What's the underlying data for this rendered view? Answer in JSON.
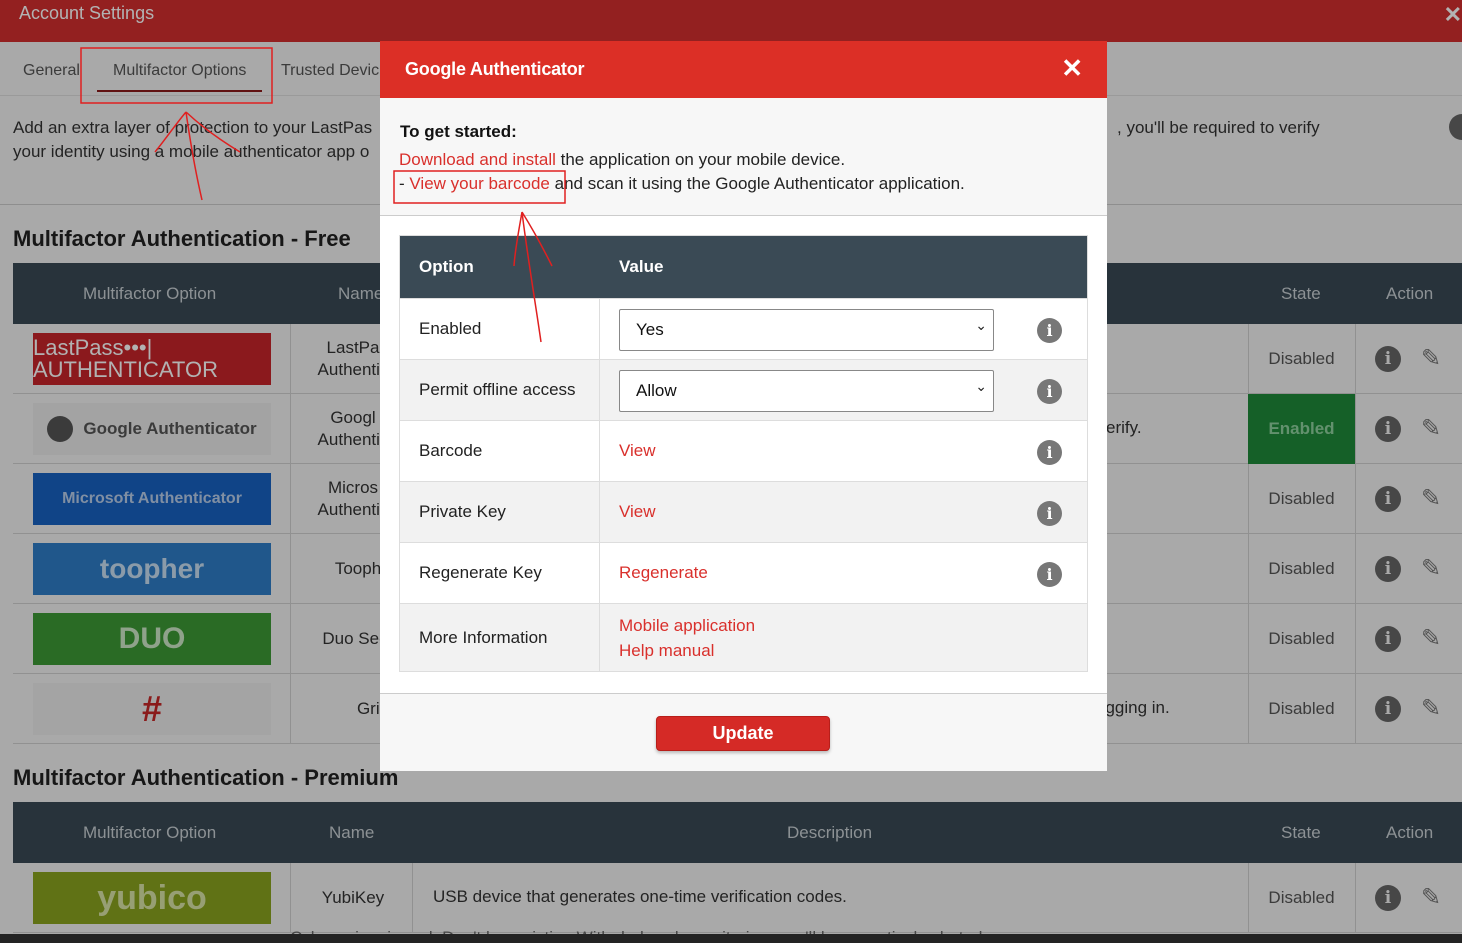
{
  "window": {
    "title": "Account Settings",
    "close_glyph": "✕"
  },
  "tabs": [
    {
      "label": "General"
    },
    {
      "label": "Multifactor Options",
      "active": true
    },
    {
      "label": "Trusted Devic"
    }
  ],
  "intro": {
    "left_line1": "Add an extra layer of protection to your LastPas",
    "left_line2": "your identity using a mobile authenticator app o",
    "right_line1": ", you'll be required to verify"
  },
  "free_section": {
    "title": "Multifactor Authentication - Free",
    "headers": {
      "option": "Multifactor Option",
      "name": "Name",
      "state": "State",
      "action": "Action"
    },
    "rows": [
      {
        "logo": "LastPass•••| AUTHENTICATOR",
        "name_l1": "LastPa",
        "name_l2": "Authentic",
        "desc": "",
        "state": "Disabled"
      },
      {
        "logo": "Google Authenticator",
        "name_l1": "Googl",
        "name_l2": "Authentic",
        "desc": "erify.",
        "state": "Enabled"
      },
      {
        "logo": "Microsoft Authenticator",
        "name_l1": "Micros",
        "name_l2": "Authentic",
        "desc": "",
        "state": "Disabled"
      },
      {
        "logo": "toopher",
        "name_l1": "Tooph",
        "name_l2": "",
        "desc": "",
        "state": "Disabled"
      },
      {
        "logo": "DUO",
        "name_l1": "Duo Sec",
        "name_l2": "",
        "desc": "",
        "state": "Disabled"
      },
      {
        "logo": "#",
        "name_l1": "Grid",
        "name_l2": "",
        "desc": "ogging in.",
        "state": "Disabled"
      }
    ]
  },
  "premium_section": {
    "title": "Multifactor Authentication - Premium",
    "headers": {
      "option": "Multifactor Option",
      "name": "Name",
      "description": "Description",
      "state": "State",
      "action": "Action"
    },
    "rows": [
      {
        "logo": "yubico",
        "name": "YubiKey",
        "desc": "USB device that generates one-time verification codes.",
        "state": "Disabled"
      }
    ]
  },
  "bottom_text": "Cyber-crime is real. Don't be a victim. With dark web monitoring, you'll be proactively alerted",
  "modal": {
    "title": "Google Authenticator",
    "close_glyph": "✕",
    "get_started": "To get started:",
    "line1_link": "Download and install",
    "line1_rest": " the application on your mobile device.",
    "line2_prefix": "- ",
    "line2_link": "View your barcode",
    "line2_rest": " and scan it using the Google Authenticator application.",
    "table": {
      "col_option": "Option",
      "col_value": "Value",
      "rows": {
        "enabled": {
          "label": "Enabled",
          "value": "Yes"
        },
        "offline": {
          "label": "Permit offline access",
          "value": "Allow"
        },
        "barcode": {
          "label": "Barcode",
          "value": "View"
        },
        "private_key": {
          "label": "Private Key",
          "value": "View"
        },
        "regenerate": {
          "label": "Regenerate Key",
          "value": "Regenerate"
        },
        "more_info": {
          "label": "More Information",
          "link1": "Mobile application",
          "link2": "Help manual"
        }
      }
    },
    "update_label": "Update"
  },
  "icons": {
    "info": "info-icon",
    "edit": "pencil-icon",
    "chevron": "chevron-down-icon",
    "close": "close-icon"
  },
  "colors": {
    "brand_red": "#dc2f26",
    "header_dark": "#3a4a55",
    "enabled_green": "#1f8a3a",
    "annotation_red": "#e02020"
  }
}
